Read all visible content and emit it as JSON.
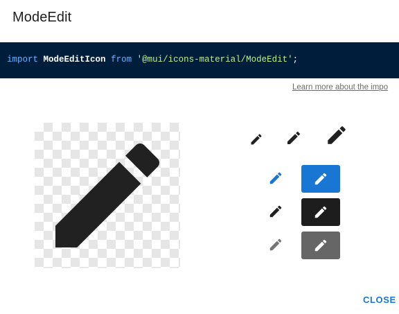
{
  "dialog": {
    "title": "ModeEdit",
    "code": {
      "keyword_import": "import",
      "identifier": "ModeEditIcon",
      "keyword_from": "from",
      "module": "'@mui/icons-material/ModeEdit'",
      "semicolon": ";"
    },
    "learn_more_link": "Learn more about the impo",
    "icon_name": "mode-edit-icon",
    "close_label": "CLOSE"
  },
  "colors": {
    "code_background": "#001e3c",
    "primary": "#1976d2",
    "dark": "#1d1d1d",
    "disabled": "#666666",
    "icon_default": "#212121"
  }
}
